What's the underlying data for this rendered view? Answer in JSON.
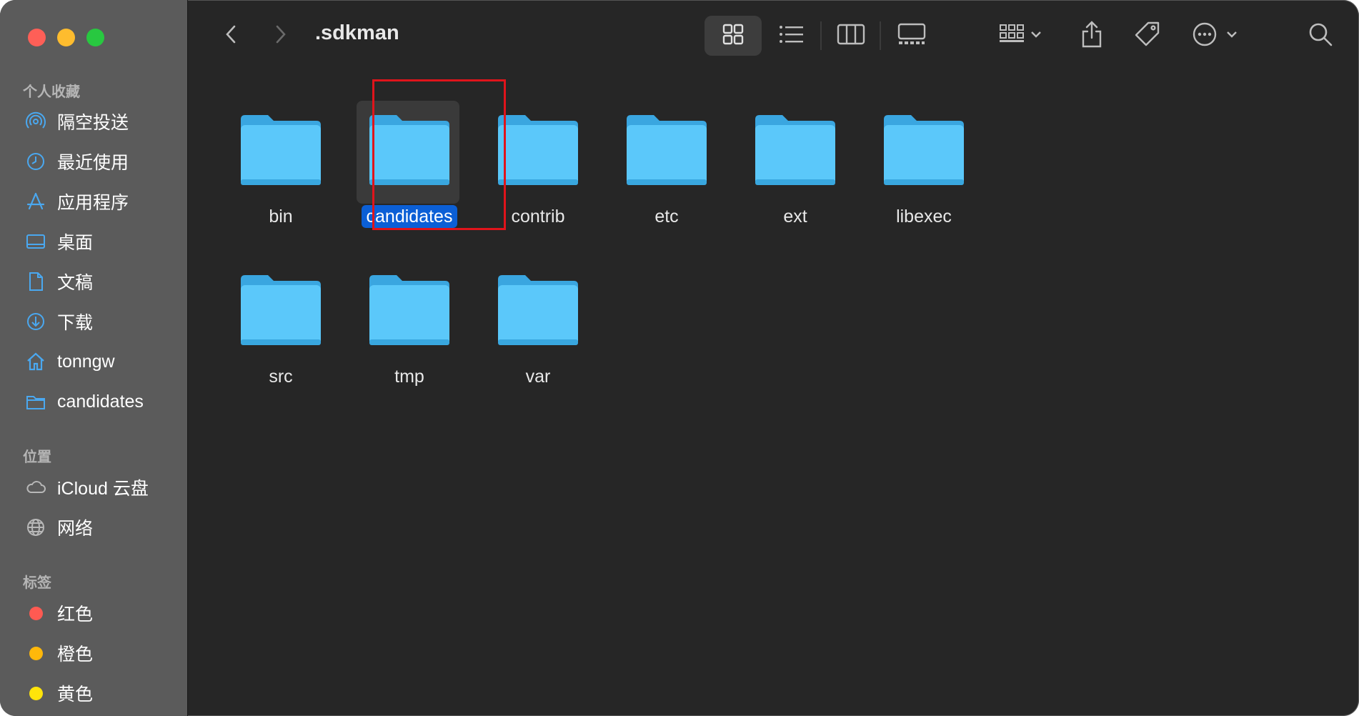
{
  "window": {
    "path_title": ".sdkman"
  },
  "sidebar": {
    "sections": [
      {
        "title": "个人收藏",
        "items": [
          {
            "label": "隔空投送",
            "icon": "airdrop-icon"
          },
          {
            "label": "最近使用",
            "icon": "clock-icon"
          },
          {
            "label": "应用程序",
            "icon": "applications-icon"
          },
          {
            "label": "桌面",
            "icon": "desktop-icon"
          },
          {
            "label": "文稿",
            "icon": "document-icon"
          },
          {
            "label": "下载",
            "icon": "download-icon"
          },
          {
            "label": "tonngw",
            "icon": "home-icon"
          },
          {
            "label": "candidates",
            "icon": "folder-icon"
          }
        ]
      },
      {
        "title": "位置",
        "items": [
          {
            "label": "iCloud 云盘",
            "icon": "cloud-icon"
          },
          {
            "label": "网络",
            "icon": "globe-icon"
          }
        ]
      },
      {
        "title": "标签",
        "items": [
          {
            "label": "红色",
            "color": "#ff5a52"
          },
          {
            "label": "橙色",
            "color": "#ffb80a"
          },
          {
            "label": "黄色",
            "color": "#ffe40a"
          }
        ]
      }
    ]
  },
  "toolbar": {
    "back": "chevron-left-icon",
    "forward": "chevron-right-icon",
    "view_modes": [
      "icon-view-icon",
      "list-view-icon",
      "column-view-icon",
      "gallery-view-icon"
    ],
    "active_view": "icon-view-icon",
    "group": "group-by-icon",
    "share": "share-icon",
    "tag": "tag-icon",
    "more": "ellipsis-icon",
    "search": "search-icon"
  },
  "folders": [
    {
      "name": "bin"
    },
    {
      "name": "candidates",
      "selected": true
    },
    {
      "name": "contrib"
    },
    {
      "name": "etc"
    },
    {
      "name": "ext"
    },
    {
      "name": "libexec"
    },
    {
      "name": "src"
    },
    {
      "name": "tmp"
    },
    {
      "name": "var"
    }
  ],
  "colors": {
    "accent": "#0b5fd6",
    "folder": "#4fc3f7",
    "annotation": "#e0141b"
  }
}
